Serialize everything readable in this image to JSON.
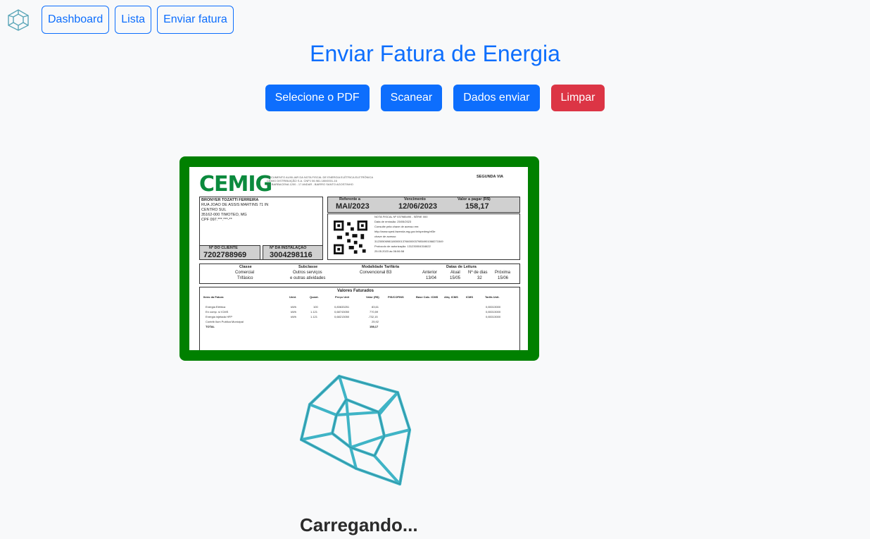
{
  "nav": {
    "logo_icon": "hypercube-logo-icon",
    "links": [
      "Dashboard",
      "Lista",
      "Enviar fatura"
    ]
  },
  "page_title": "Enviar Fatura de Energia",
  "actions": {
    "select_pdf": "Selecione o PDF",
    "scan": "Scanear",
    "send_data": "Dados enviar",
    "clear": "Limpar"
  },
  "invoice": {
    "brand": "CEMIG",
    "copy_label": "SEGUNDA VIA",
    "customer": {
      "name": "BRONYER TOZATTI FERREIRA",
      "address1": "RUA JOAO DE ASSIS MARTINS 71 IN",
      "address2": "CENTRO SUL",
      "address3": "35162-000 TIMOTEO, MG",
      "cpf": "CPF 097.***.***-**"
    },
    "client_number_label": "Nº DO CLIENTE",
    "client_number": "7202788969",
    "installation_label": "Nº DA INSTALAÇÃO",
    "installation_number": "3004298116",
    "reference_label": "Referente a",
    "reference": "MAI/2023",
    "due_label": "Vencimento",
    "due": "12/06/2023",
    "amount_label": "Valor a pagar (R$)",
    "amount": "158,17",
    "nf_lines": [
      "NOTA FISCAL Nº 037985490 - SÉRIE 000",
      "Data de emissão: 25/05/2023",
      "Consulte pela chave de acesso em:",
      "http://www.sped.fazenda.mg.gov.br/spedmg/nf3e",
      "chave de acesso:",
      "31230506981180000137660000379854901068271549",
      "Protocolo de autorização: 131230004316622",
      "25.05.2023 às 06:06:58"
    ],
    "class_label": "Classe",
    "class_values": [
      "Comercial",
      "Trifásico"
    ],
    "subclass_label": "Subclasse",
    "subclass_values": [
      "Outros serviços",
      "e outras atividades"
    ],
    "tariff_label": "Modalidade Tarifária",
    "tariff_value": "Convencional B3",
    "reading_label": "Datas de Leitura",
    "reading_cols": [
      "Anterior",
      "Atual",
      "Nº de dias",
      "Próxima"
    ],
    "reading_vals": [
      "13/04",
      "15/05",
      "32",
      "15/06"
    ],
    "billed_title": "Valores Faturados",
    "billed_headers": [
      "Itens da Fatura",
      "Unid.",
      "Quant.",
      "Preço Unit",
      "Valor (R$)",
      "PIS/COFINS",
      "Base Calc. ICMS",
      "Alíq. ICMS",
      "ICMS",
      "Tarifa Unit."
    ],
    "billed_rows": [
      [
        "Energia Elétrica",
        "kWh",
        "100",
        "0,83633251",
        "83,61",
        "0,65313000"
      ],
      [
        "En comp. s/ ICMS",
        "kWh",
        "1.121",
        "0,68743050",
        "770,59",
        "0,65313000"
      ],
      [
        "Energia injetada HFP",
        "kWh",
        "1.121",
        "0,68213050",
        "-732,15",
        "0,65313000"
      ],
      [
        "Contrib Ilum Publica Municipal",
        "",
        "",
        "",
        "25,92",
        ""
      ],
      [
        "TOTAL",
        "",
        "",
        "",
        "158,17",
        ""
      ]
    ]
  },
  "loader_icon": "hypercube-spinner-icon",
  "status_text": "Carregando...",
  "colors": {
    "primary": "#0d6efd",
    "danger": "#dc3545",
    "frame": "#008000",
    "cube": "#3fb4c6"
  }
}
